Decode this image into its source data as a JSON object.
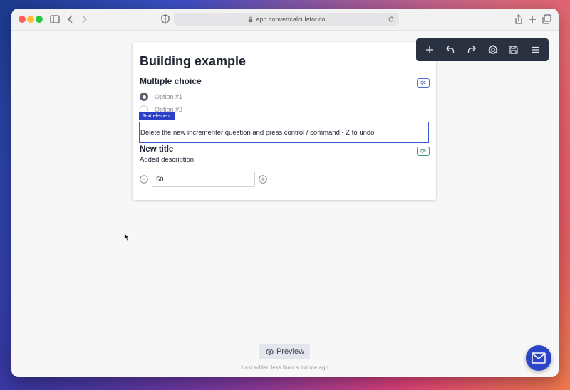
{
  "browser": {
    "url": "app.convertcalculator.co"
  },
  "form": {
    "title": "Building example",
    "multiple_choice": {
      "title": "Multiple choice",
      "tag": "QC",
      "options": [
        "Option #1",
        "Option #2"
      ],
      "selected_index": 0
    },
    "text_element": {
      "tag": "Text element",
      "text": "Delete the new incrementer question and press control / command - Z to undo"
    },
    "incrementer": {
      "title": "New title",
      "tag": "QB",
      "description": "Added description",
      "value": "50"
    }
  },
  "editor_toolbar": {
    "icons": [
      "plus-icon",
      "undo-icon",
      "redo-icon",
      "gear-icon",
      "save-icon",
      "menu-icon"
    ]
  },
  "footer": {
    "preview_label": "Preview",
    "last_edited": "Last edited less than a minute ago"
  },
  "colors": {
    "accent": "#2b3fc9",
    "toolbar_bg": "#2a3140"
  }
}
